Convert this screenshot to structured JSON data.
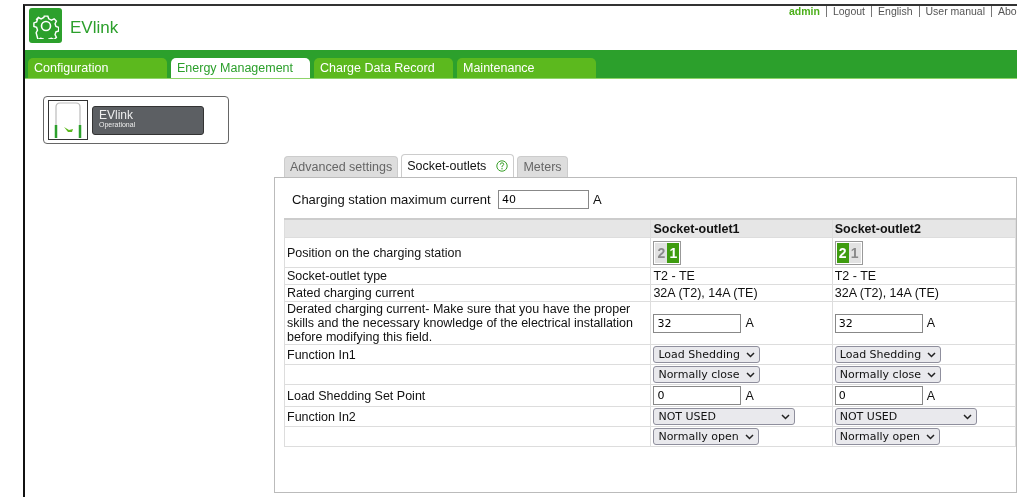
{
  "header": {
    "title": "EVlink",
    "user": "admin",
    "links": [
      "Logout",
      "English",
      "User manual",
      "Abo"
    ]
  },
  "tabs": [
    {
      "label": "Configuration",
      "selected": false
    },
    {
      "label": "Energy Management",
      "selected": true
    },
    {
      "label": "Charge Data Record",
      "selected": false
    },
    {
      "label": "Maintenance",
      "selected": false
    }
  ],
  "station": {
    "name": "EVlink",
    "status": "Operational"
  },
  "subtabs": [
    {
      "label": "Advanced settings",
      "selected": false,
      "help": false
    },
    {
      "label": "Socket-outlets",
      "selected": true,
      "help": true
    },
    {
      "label": "Meters",
      "selected": false,
      "help": false
    }
  ],
  "max_current": {
    "label": "Charging station maximum current",
    "value": "40",
    "unit": "A"
  },
  "table": {
    "columns": [
      "Socket-outlet1",
      "Socket-outlet2"
    ],
    "rows": [
      {
        "label": "Position on the charging station",
        "cells": [
          {
            "kind": "position",
            "slots": [
              {
                "label": "2",
                "selected": false
              },
              {
                "label": "1",
                "selected": true
              }
            ]
          },
          {
            "kind": "position",
            "slots": [
              {
                "label": "2",
                "selected": true
              },
              {
                "label": "1",
                "selected": false
              }
            ]
          }
        ]
      },
      {
        "label": "Socket-outlet type",
        "cells": [
          {
            "kind": "text",
            "value": "T2 - TE"
          },
          {
            "kind": "text",
            "value": "T2 - TE"
          }
        ]
      },
      {
        "label": "Rated charging current",
        "cells": [
          {
            "kind": "text",
            "value": "32A (T2), 14A (TE)"
          },
          {
            "kind": "text",
            "value": "32A (T2), 14A (TE)"
          }
        ]
      },
      {
        "label": "Derated charging current- Make sure that you have the proper skills and the necessary knowledge of the electrical installation before modifying this field.",
        "cells": [
          {
            "kind": "input",
            "value": "32",
            "unit": "A"
          },
          {
            "kind": "input",
            "value": "32",
            "unit": "A"
          }
        ]
      },
      {
        "label": "Function In1",
        "cells": [
          {
            "kind": "select",
            "value": "Load Shedding"
          },
          {
            "kind": "select",
            "value": "Load Shedding"
          }
        ]
      },
      {
        "cells": [
          {
            "kind": "select",
            "value": "Normally close"
          },
          {
            "kind": "select",
            "value": "Normally close"
          }
        ]
      },
      {
        "label": "Load Shedding Set Point",
        "cells": [
          {
            "kind": "input",
            "value": "0",
            "unit": "A"
          },
          {
            "kind": "input",
            "value": "0",
            "unit": "A"
          }
        ]
      },
      {
        "label": "Function In2",
        "cells": [
          {
            "kind": "wide-select",
            "value": "NOT USED"
          },
          {
            "kind": "wide-select",
            "value": "NOT USED"
          }
        ]
      },
      {
        "cells": [
          {
            "kind": "select",
            "value": "Normally open"
          },
          {
            "kind": "select",
            "value": "Normally open"
          }
        ]
      }
    ]
  }
}
